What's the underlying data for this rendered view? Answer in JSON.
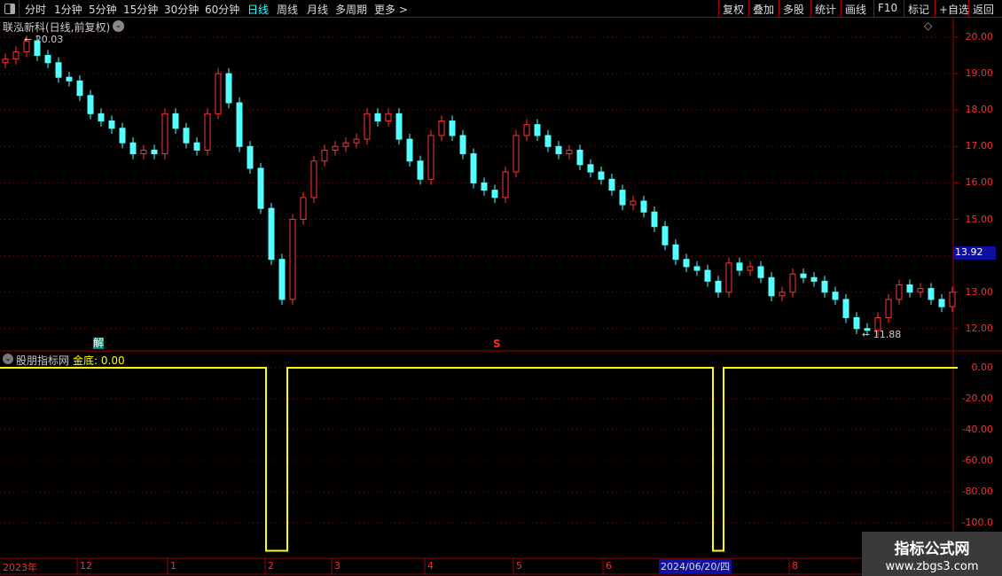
{
  "toolbar": {
    "tabs": [
      "分时",
      "1分钟",
      "5分钟",
      "15分钟",
      "30分钟",
      "60分钟",
      "日线",
      "周线",
      "月线",
      "多周期",
      "更多 >"
    ],
    "active": "日线",
    "right_buttons": [
      "复权",
      "叠加",
      "多股",
      "统计",
      "画线",
      "F10",
      "标记",
      "+自选",
      "返回"
    ]
  },
  "main": {
    "title": "联泓新科(日线,前复权)",
    "high_label": "20.03",
    "low_label": "11.88",
    "current_price": "13.92",
    "marker_jie": "解",
    "marker_s": "S",
    "price_ticks": [
      "20.00",
      "19.00",
      "18.00",
      "17.00",
      "16.00",
      "15.00",
      "14.00",
      "13.00",
      "12.00"
    ]
  },
  "indicator": {
    "name": "股朋指标网",
    "series_label": "金底:",
    "series_value": "0.00",
    "ticks": [
      "0.00",
      "-20.00",
      "-40.00",
      "-60.00",
      "-80.00",
      "-100.0"
    ]
  },
  "time_axis": {
    "labels": [
      "2023年",
      "12",
      "1",
      "2",
      "3",
      "4",
      "5",
      "6",
      "8"
    ],
    "cursor_date": "2024/06/20/四"
  },
  "watermark": {
    "line1": "指标公式网",
    "line2": "www.zbgs3.com"
  },
  "colors": {
    "up": "#ff3232",
    "down": "#54ffff",
    "indicator": "#ffff00",
    "grid": "#a00000",
    "current_bg": "#1010a0"
  },
  "chart_data": {
    "type": "candlestick",
    "ylim": [
      11.7,
      20.3
    ],
    "closes": [
      19.4,
      19.6,
      19.9,
      19.5,
      19.3,
      18.9,
      18.8,
      18.4,
      17.9,
      17.7,
      17.5,
      17.1,
      16.8,
      16.9,
      16.8,
      17.9,
      17.5,
      17.1,
      16.9,
      17.9,
      19.0,
      18.2,
      17.0,
      16.4,
      15.3,
      13.9,
      12.8,
      15.0,
      15.6,
      16.6,
      16.9,
      17.0,
      17.1,
      17.2,
      17.9,
      17.7,
      17.9,
      17.2,
      16.6,
      16.1,
      17.3,
      17.7,
      17.3,
      16.8,
      16.0,
      15.8,
      15.6,
      16.3,
      17.3,
      17.6,
      17.3,
      17.0,
      16.8,
      16.9,
      16.5,
      16.3,
      16.1,
      15.8,
      15.4,
      15.5,
      15.2,
      14.8,
      14.3,
      13.9,
      13.7,
      13.6,
      13.3,
      13.0,
      13.8,
      13.6,
      13.7,
      13.4,
      12.9,
      13.0,
      13.5,
      13.4,
      13.3,
      13.0,
      12.8,
      12.3,
      12.0,
      11.95,
      12.3,
      12.8,
      13.2,
      13.0,
      13.1,
      12.8,
      12.6,
      13.0
    ],
    "indicator_values_nonzero": {
      "25": -118,
      "26": -118,
      "67": -118
    },
    "indicator_ylim": [
      -120,
      5
    ]
  }
}
